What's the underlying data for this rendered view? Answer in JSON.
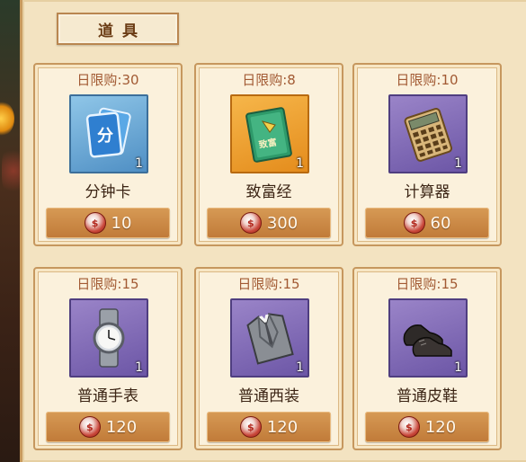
{
  "panel": {
    "tab_label": "道具"
  },
  "items": [
    {
      "limit": "日限购:30",
      "name": "分钟卡",
      "qty": "1",
      "price": "10",
      "icon": "minute-card-icon",
      "bg": "blue"
    },
    {
      "limit": "日限购:8",
      "name": "致富经",
      "qty": "1",
      "price": "300",
      "icon": "wealth-book-icon",
      "bg": "gold"
    },
    {
      "limit": "日限购:10",
      "name": "计算器",
      "qty": "1",
      "price": "60",
      "icon": "calculator-icon",
      "bg": "purple"
    },
    {
      "limit": "日限购:15",
      "name": "普通手表",
      "qty": "1",
      "price": "120",
      "icon": "wristwatch-icon",
      "bg": "purple"
    },
    {
      "limit": "日限购:15",
      "name": "普通西装",
      "qty": "1",
      "price": "120",
      "icon": "suit-icon",
      "bg": "purple"
    },
    {
      "limit": "日限购:15",
      "name": "普通皮鞋",
      "qty": "1",
      "price": "120",
      "icon": "leather-shoes-icon",
      "bg": "purple"
    }
  ],
  "icon_labels": {
    "minute_card_text": "分",
    "wealth_book_text": "致富"
  },
  "colors": {
    "panel_bg": "#f3e3c1",
    "card_border": "#c6975e",
    "price_bar": "#c98a45",
    "limit_text": "#a25a33"
  }
}
